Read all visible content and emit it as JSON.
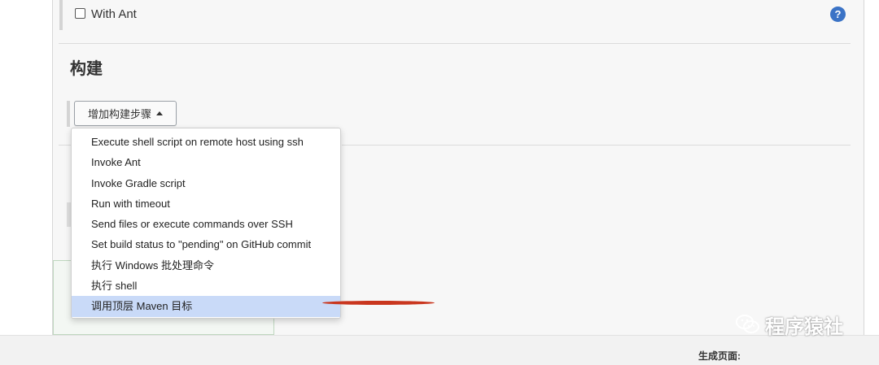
{
  "option": {
    "label": "With Ant"
  },
  "section": {
    "title": "构建"
  },
  "add_step_button": {
    "label": "增加构建步骤"
  },
  "menu": {
    "items": [
      "Execute shell script on remote host using ssh",
      "Invoke Ant",
      "Invoke Gradle script",
      "Run with timeout",
      "Send files or execute commands over SSH",
      "Set build status to \"pending\" on GitHub commit",
      "执行 Windows 批处理命令",
      "执行 shell",
      "调用顶层 Maven 目标"
    ],
    "active_index": 8
  },
  "footer": {
    "label": "生成页面:"
  },
  "watermark": {
    "text": "程序猿社"
  },
  "colors": {
    "accent": "#3b73c6",
    "highlight": "#c9daf8",
    "annotation": "#c9361e"
  },
  "icons": {
    "help": "question-icon",
    "dropdown": "caret-up-icon",
    "watermark": "wechat-icon"
  }
}
